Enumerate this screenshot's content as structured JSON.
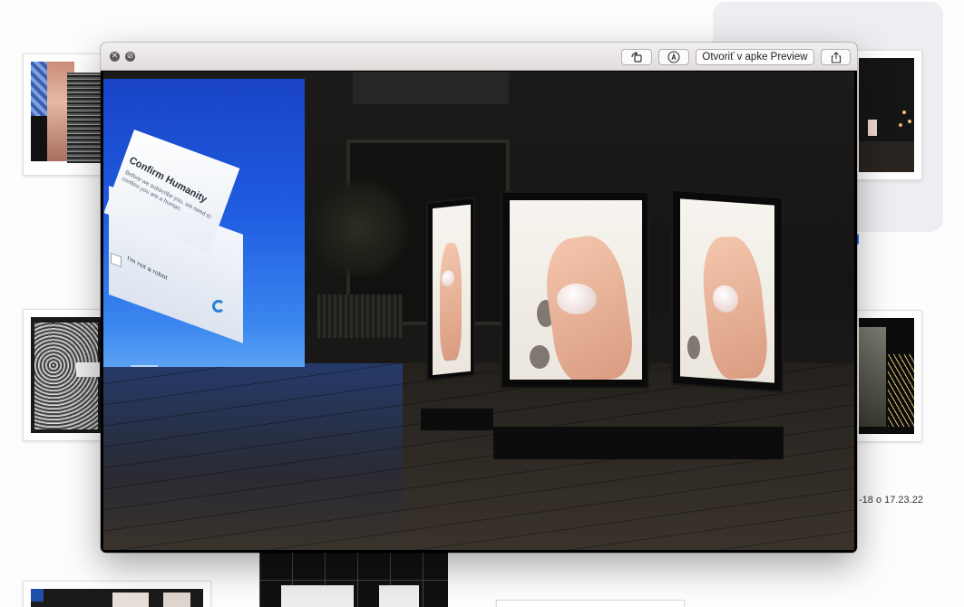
{
  "quicklook": {
    "close_glyph": "✕",
    "fullscreen_glyph": "⊘",
    "toolbar": {
      "rotate_icon": "rotate-icon",
      "markup_icon": "markup-icon",
      "open_label": "Otvoriť v apke Preview",
      "share_icon": "share-icon"
    },
    "preview": {
      "cube_title": "Confirm Humanity",
      "cube_subtitle": "Before we subscribe you, we need to confirm you are a human.",
      "cube_checkbox_label": "I'm not a robot"
    }
  },
  "background": {
    "timestamp": "-18 o 17.23.22"
  },
  "colors": {
    "projection_blue": "#1e5be0",
    "toolbar_bg": "#ebe7e6",
    "accent": "#1b6bff"
  }
}
